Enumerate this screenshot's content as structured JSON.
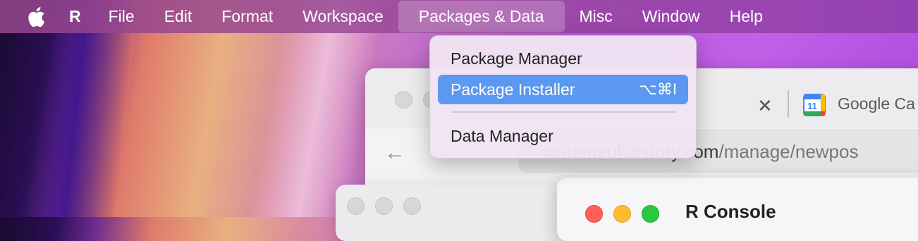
{
  "menubar": {
    "app_name": "R",
    "items": [
      "File",
      "Edit",
      "Format",
      "Workspace",
      "Packages & Data",
      "Misc",
      "Window",
      "Help"
    ],
    "active_item": "Packages & Data"
  },
  "dropdown": {
    "items": [
      {
        "label": "Package Manager",
        "shortcut": ""
      },
      {
        "label": "Package Installer",
        "shortcut": "⌥⌘I"
      },
      {
        "label": "Data Manager",
        "shortcut": ""
      }
    ],
    "highlighted_index": 1
  },
  "browser": {
    "tab_title": "Google Ca",
    "calendar_day": "11",
    "url_host": "writemeuk.tistory.com",
    "url_path": "/manage/newpos"
  },
  "console": {
    "title": "R Console"
  },
  "colors": {
    "highlight": "#5b98ef",
    "close_red": "#fe5f57",
    "minimize_yellow": "#febc2e",
    "zoom_green": "#28c840"
  }
}
